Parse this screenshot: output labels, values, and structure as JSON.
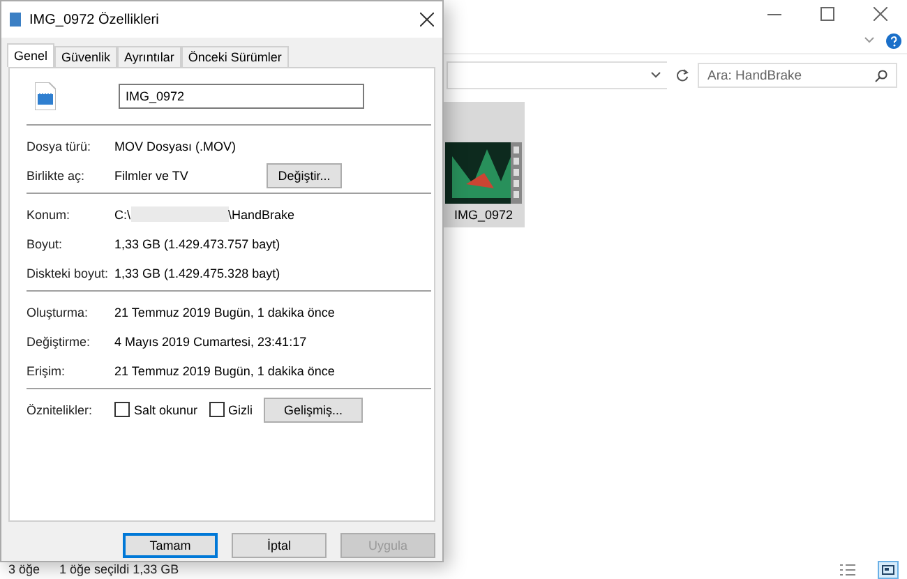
{
  "explorer": {
    "search": {
      "placeholder": "Ara: HandBrake"
    },
    "files": [
      {
        "name": "IMG_0972",
        "selected": true
      }
    ],
    "status_bar": [
      "3 öğe",
      "1 öğe seçildi  1,33 GB"
    ],
    "views": [
      {
        "kind": "details",
        "selected": false
      },
      {
        "kind": "large",
        "selected": true
      }
    ]
  },
  "dialog": {
    "title": "IMG_0972 Özellikleri",
    "tabs": [
      {
        "label": "Genel",
        "selected": true
      },
      {
        "label": "Güvenlik",
        "selected": false
      },
      {
        "label": "Ayrıntılar",
        "selected": false
      },
      {
        "label": "Önceki Sürümler",
        "selected": false
      }
    ],
    "name_value": "IMG_0972",
    "sections": [
      [
        {
          "label": "Dosya türü:",
          "value": "MOV Dosyası (.MOV)"
        },
        {
          "label": "Birlikte aç:",
          "value": "Filmler ve TV",
          "button": "Değiştir..."
        }
      ],
      [
        {
          "label": "Konum:",
          "value": "C:\\",
          "redacted": true,
          "value_end": "\\HandBrake"
        },
        {
          "label": "Boyut:",
          "value": "1,33 GB (1.429.473.757 bayt)"
        },
        {
          "label": "Diskteki boyut:",
          "value": "1,33 GB (1.429.475.328 bayt)"
        }
      ],
      [
        {
          "label": "Oluşturma:",
          "value": "21 Temmuz 2019 Bugün, 1 dakika önce"
        },
        {
          "label": "Değiştirme:",
          "value": "4 Mayıs 2019 Cumartesi, 23:41:17"
        },
        {
          "label": "Erişim:",
          "value": "21 Temmuz 2019 Bugün, 1 dakika önce"
        }
      ]
    ],
    "attributes": {
      "label": "Öznitelikler:",
      "checks": [
        {
          "label": "Salt okunur",
          "checked": false
        },
        {
          "label": "Gizli",
          "checked": false
        }
      ],
      "button": "Gelişmiş..."
    },
    "buttons": [
      {
        "label": "Tamam",
        "kind": "default"
      },
      {
        "label": "İptal",
        "kind": "normal"
      },
      {
        "label": "Uygula",
        "kind": "disabled"
      }
    ]
  }
}
